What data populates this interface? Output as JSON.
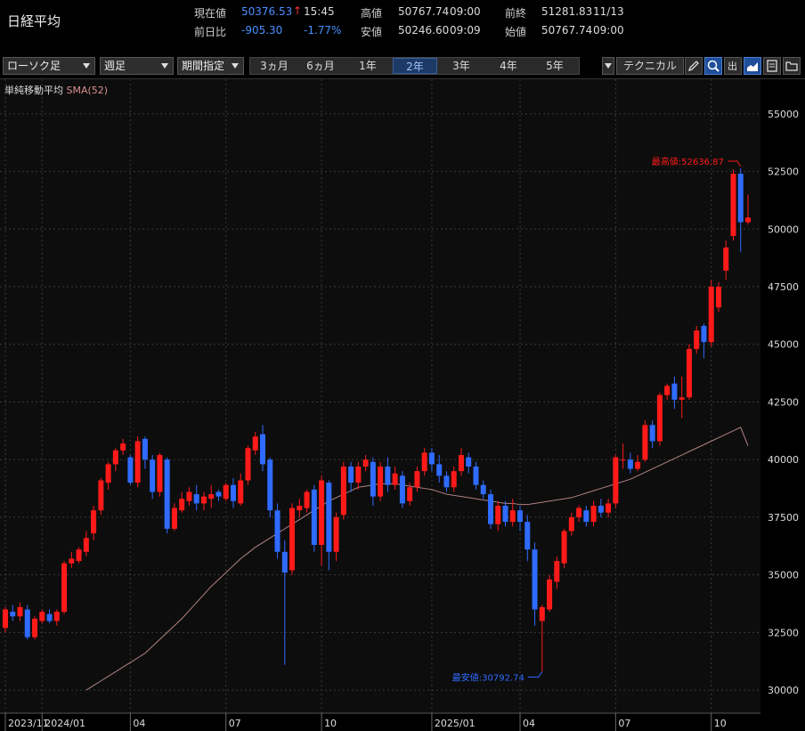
{
  "title": "日経平均",
  "quote": {
    "current_label": "現在値",
    "current_value": "50376.53",
    "current_time": "15:45",
    "change_label": "前日比",
    "change_value": "-905.30",
    "change_pct": "-1.77%",
    "high_label": "高値",
    "high_value": "50767.74",
    "high_time": "09:00",
    "low_label": "安値",
    "low_value": "50246.60",
    "low_time": "09:09",
    "prev_label": "前終",
    "prev_value": "51281.83",
    "prev_date": "11/13",
    "open_label": "始値",
    "open_value": "50767.74",
    "open_time": "09:00"
  },
  "toolbar": {
    "chart_type": "ローソク足",
    "interval": "週足",
    "range_mode": "期間指定",
    "periods": [
      "3ヵ月",
      "6ヵ月",
      "1年",
      "2年",
      "3年",
      "4年",
      "5年"
    ],
    "active_period": "2年",
    "technical": "テクニカル",
    "icons": [
      "pencil-icon",
      "zoom-icon",
      "output-icon",
      "area-chart-icon",
      "save-icon",
      "folder-icon"
    ]
  },
  "indicator": {
    "name": "単純移動平均",
    "sma": "SMA(52)"
  },
  "colors": {
    "up": "#ff1a1a",
    "down": "#2f6bff",
    "sma": "#d9a0a0",
    "grid": "#3a3a3a",
    "bg": "#0d0d0d"
  },
  "chart_data": {
    "type": "candlestick",
    "interval": "weekly",
    "y_ticks": [
      30000,
      32500,
      35000,
      37500,
      40000,
      42500,
      45000,
      47500,
      50000,
      52500,
      55000
    ],
    "ylim": [
      29000,
      56500
    ],
    "x_labels": [
      "2023/11",
      "2024/01",
      "04",
      "07",
      "10",
      "2025/01",
      "04",
      "07",
      "10"
    ],
    "x_label_index": [
      0,
      5,
      17,
      30,
      43,
      58,
      70,
      83,
      96
    ],
    "high_annotation": "最高値:52636.87",
    "low_annotation": "最安値:30792.74",
    "sma_name": "SMA(52)",
    "candles": [
      [
        32700,
        33500,
        32500,
        33600
      ],
      [
        33400,
        33200,
        33000,
        33700
      ],
      [
        33200,
        33600,
        33000,
        33800
      ],
      [
        33500,
        32300,
        32200,
        33700
      ],
      [
        32300,
        33100,
        32200,
        33200
      ],
      [
        33000,
        33400,
        32900,
        33500
      ],
      [
        33300,
        33000,
        32900,
        33500
      ],
      [
        33000,
        33400,
        32800,
        33500
      ],
      [
        33400,
        35500,
        33300,
        35600
      ],
      [
        35500,
        35700,
        35300,
        36000
      ],
      [
        35600,
        36100,
        35500,
        36200
      ],
      [
        36000,
        36600,
        35800,
        36900
      ],
      [
        36800,
        37800,
        36500,
        38000
      ],
      [
        37800,
        39100,
        37600,
        39200
      ],
      [
        39000,
        39800,
        38700,
        39900
      ],
      [
        39800,
        40400,
        39500,
        40500
      ],
      [
        40400,
        40700,
        40200,
        40900
      ],
      [
        40100,
        39000,
        38900,
        40200
      ],
      [
        39000,
        40800,
        38800,
        41000
      ],
      [
        40900,
        40000,
        39600,
        41000
      ],
      [
        40000,
        38600,
        38300,
        40200
      ],
      [
        38600,
        40200,
        38400,
        40300
      ],
      [
        40000,
        37000,
        36800,
        40100
      ],
      [
        37000,
        37900,
        36900,
        38100
      ],
      [
        37800,
        38300,
        37700,
        38600
      ],
      [
        38200,
        38600,
        38000,
        38800
      ],
      [
        38500,
        38100,
        37800,
        38900
      ],
      [
        38100,
        38400,
        37800,
        38600
      ],
      [
        38300,
        38500,
        37900,
        38900
      ],
      [
        38600,
        38400,
        38200,
        38700
      ],
      [
        38300,
        38900,
        38200,
        39000
      ],
      [
        38900,
        38200,
        37900,
        39200
      ],
      [
        38100,
        39100,
        38000,
        39400
      ],
      [
        39100,
        40500,
        38900,
        40600
      ],
      [
        40400,
        41000,
        40200,
        41200
      ],
      [
        41100,
        39800,
        39500,
        41500
      ],
      [
        40000,
        37800,
        37500,
        40100
      ],
      [
        37800,
        36000,
        35700,
        38100
      ],
      [
        36000,
        35100,
        31100,
        36500
      ],
      [
        35200,
        37900,
        35000,
        38100
      ],
      [
        37800,
        38000,
        37500,
        38300
      ],
      [
        37900,
        38600,
        37700,
        38700
      ],
      [
        38700,
        36300,
        36000,
        38900
      ],
      [
        36300,
        39100,
        35400,
        39300
      ],
      [
        39000,
        36000,
        35200,
        39100
      ],
      [
        36000,
        37500,
        35600,
        37700
      ],
      [
        37600,
        39700,
        37400,
        39900
      ],
      [
        39700,
        39000,
        38600,
        39900
      ],
      [
        39000,
        39700,
        38700,
        39900
      ],
      [
        39700,
        40000,
        39500,
        40200
      ],
      [
        39900,
        38400,
        38000,
        40100
      ],
      [
        38400,
        39700,
        38200,
        39900
      ],
      [
        39700,
        38900,
        38600,
        40100
      ],
      [
        38900,
        39400,
        38700,
        39700
      ],
      [
        39300,
        38100,
        37900,
        39500
      ],
      [
        38200,
        38800,
        38000,
        39000
      ],
      [
        38800,
        39500,
        38600,
        39700
      ],
      [
        39500,
        40300,
        39300,
        40500
      ],
      [
        40300,
        39800,
        39500,
        40500
      ],
      [
        39800,
        39300,
        39000,
        40200
      ],
      [
        39300,
        38800,
        38600,
        39500
      ],
      [
        38800,
        39500,
        38600,
        39700
      ],
      [
        39500,
        40200,
        39300,
        40500
      ],
      [
        40100,
        39700,
        39400,
        40300
      ],
      [
        39700,
        38900,
        38700,
        39900
      ],
      [
        38900,
        38500,
        38300,
        39100
      ],
      [
        38500,
        37200,
        37000,
        38700
      ],
      [
        37200,
        38000,
        36900,
        38200
      ],
      [
        38000,
        37300,
        37100,
        38200
      ],
      [
        37300,
        37800,
        37100,
        38300
      ],
      [
        37800,
        37300,
        36900,
        38000
      ],
      [
        37300,
        36100,
        35600,
        37600
      ],
      [
        36100,
        33500,
        32800,
        36400
      ],
      [
        33000,
        33600,
        30800,
        33700
      ],
      [
        33500,
        34800,
        33400,
        35000
      ],
      [
        34700,
        35600,
        34400,
        35800
      ],
      [
        35500,
        36900,
        35300,
        37000
      ],
      [
        36900,
        37500,
        36700,
        37700
      ],
      [
        37500,
        37900,
        37300,
        38000
      ],
      [
        37800,
        37300,
        37100,
        38000
      ],
      [
        37300,
        38000,
        37100,
        38200
      ],
      [
        38000,
        37700,
        37500,
        38300
      ],
      [
        37700,
        38100,
        37500,
        38300
      ],
      [
        38100,
        40100,
        37900,
        40200
      ],
      [
        40000,
        40000,
        39600,
        40700
      ],
      [
        40000,
        39600,
        39400,
        40300
      ],
      [
        39600,
        39900,
        39500,
        40200
      ],
      [
        40000,
        41500,
        39900,
        41700
      ],
      [
        41500,
        40800,
        40500,
        41700
      ],
      [
        40800,
        42800,
        40600,
        42900
      ],
      [
        42800,
        43200,
        42600,
        43300
      ],
      [
        43300,
        42600,
        42200,
        43600
      ],
      [
        42600,
        42700,
        41800,
        43600
      ],
      [
        42700,
        44800,
        42600,
        45000
      ],
      [
        44800,
        45600,
        44600,
        45800
      ],
      [
        45800,
        45100,
        44400,
        45900
      ],
      [
        45100,
        47500,
        44900,
        47800
      ],
      [
        46600,
        47500,
        46400,
        47700
      ],
      [
        48200,
        49200,
        47800,
        49500
      ],
      [
        49700,
        52400,
        49500,
        52600
      ],
      [
        52400,
        50300,
        49000,
        52636.87
      ],
      [
        50300,
        50500,
        50200,
        51500
      ]
    ],
    "sma": [
      30000,
      30200,
      30400,
      30600,
      30800,
      31000,
      31200,
      31400,
      31600,
      31900,
      32200,
      32500,
      32800,
      33100,
      33450,
      33800,
      34150,
      34500,
      34800,
      35100,
      35400,
      35700,
      35950,
      36200,
      36400,
      36600,
      36800,
      37000,
      37200,
      37400,
      37600,
      37800,
      38000,
      38200,
      38350,
      38500,
      38650,
      38800,
      38850,
      38900,
      38950,
      38950,
      38950,
      38900,
      38850,
      38800,
      38750,
      38700,
      38600,
      38500,
      38450,
      38400,
      38350,
      38300,
      38250,
      38200,
      38150,
      38100,
      38100,
      38050,
      38050,
      38100,
      38150,
      38200,
      38250,
      38300,
      38350,
      38450,
      38550,
      38650,
      38750,
      38850,
      38950,
      39050,
      39150,
      39300,
      39450,
      39600,
      39750,
      39900,
      40050,
      40200,
      40350,
      40500,
      40650,
      40800,
      40950,
      41100,
      41250,
      41400,
      40600
    ]
  }
}
